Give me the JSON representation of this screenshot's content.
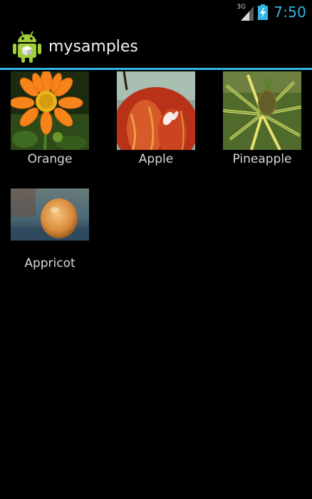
{
  "status_bar": {
    "network_type": "3G",
    "time": "7:50",
    "signal_icon": "signal-icon",
    "battery_icon": "battery-charging-icon",
    "accent_color": "#33b5e5"
  },
  "action_bar": {
    "app_icon": "android-icon",
    "title": "mysamples",
    "divider_color": "#33b5e5"
  },
  "grid": {
    "items": [
      {
        "label": "Orange",
        "image": "orange-flower-image"
      },
      {
        "label": "Apple",
        "image": "apple-image"
      },
      {
        "label": "Pineapple",
        "image": "pineapple-image"
      },
      {
        "label": "Appricot",
        "image": "apricot-image"
      }
    ]
  }
}
